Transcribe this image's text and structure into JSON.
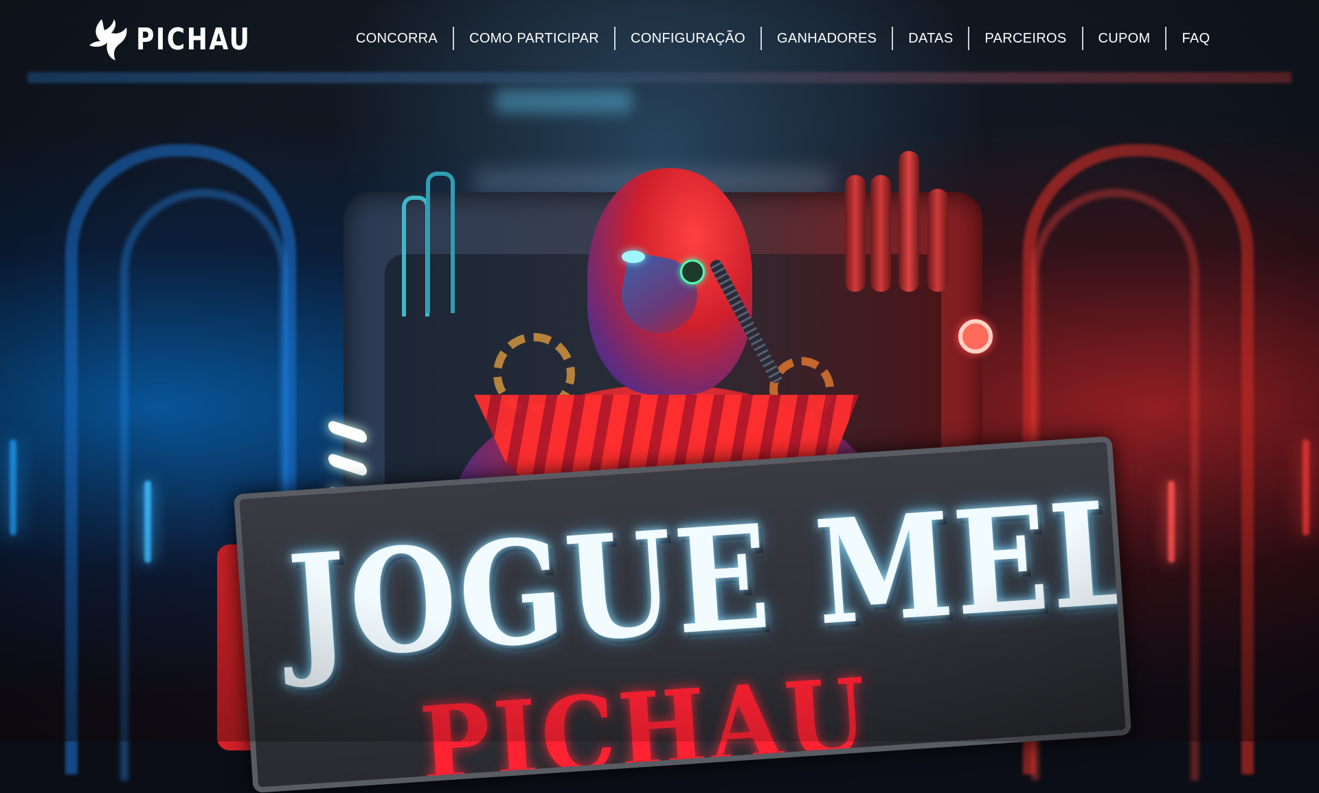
{
  "brand": {
    "name": "PICHAU",
    "logo_icon": "pichau-bird-logo-icon"
  },
  "nav": {
    "items": [
      {
        "label": "CONCORRA"
      },
      {
        "label": "COMO PARTICIPAR"
      },
      {
        "label": "CONFIGURAÇÃO"
      },
      {
        "label": "GANHADORES"
      },
      {
        "label": "DATAS"
      },
      {
        "label": "PARCEIROS"
      },
      {
        "label": "CUPOM"
      },
      {
        "label": "FAQ"
      }
    ]
  },
  "hero": {
    "title": "JOGUE MELHOR",
    "subtitle": "PICHAU"
  },
  "colors": {
    "accent_blue": "#1e90ff",
    "accent_red": "#ff2233",
    "nav_text": "#ffffff"
  }
}
